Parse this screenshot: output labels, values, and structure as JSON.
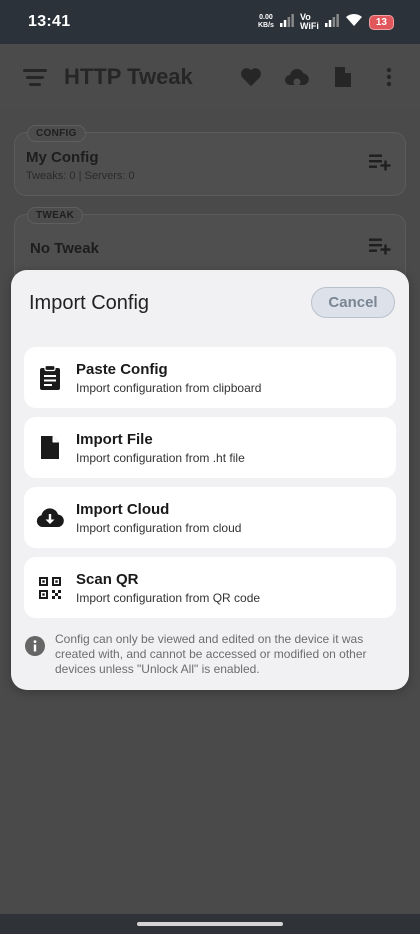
{
  "status_bar": {
    "time": "13:41",
    "net_speed_value": "0.00",
    "net_speed_unit": "KB/s",
    "volte_line1": "Vo",
    "volte_line2": "WiFi",
    "battery": "13"
  },
  "app_bar": {
    "title": "HTTP Tweak",
    "icons": [
      "menu-icon",
      "heart-icon",
      "cloud-icon",
      "file-icon",
      "more-icon"
    ]
  },
  "config_card": {
    "chip": "CONFIG",
    "name": "My Config",
    "summary": "Tweaks: 0 | Servers: 0"
  },
  "tweak_card": {
    "chip": "TWEAK",
    "name": "No Tweak"
  },
  "import_sheet": {
    "title": "Import Config",
    "cancel_label": "Cancel",
    "options": [
      {
        "title": "Paste Config",
        "description": "Import configuration from clipboard",
        "icon": "clipboard-icon"
      },
      {
        "title": "Import File",
        "description": "Import configuration from .ht file",
        "icon": "file-icon"
      },
      {
        "title": "Import Cloud",
        "description": "Import configuration from cloud",
        "icon": "cloud-download-icon"
      },
      {
        "title": "Scan QR",
        "description": "Import configuration from QR code",
        "icon": "qr-code-icon"
      }
    ],
    "note": "Config can only be viewed and edited on the device it was created with, and cannot be accessed or modified on other devices unless \"Unlock All\" is enabled."
  },
  "colors": {
    "sheet_background": "#f1f1f3",
    "option_background": "#ffffff",
    "cancel_background": "#dde2ea",
    "scrim": "#4a4a4a"
  }
}
